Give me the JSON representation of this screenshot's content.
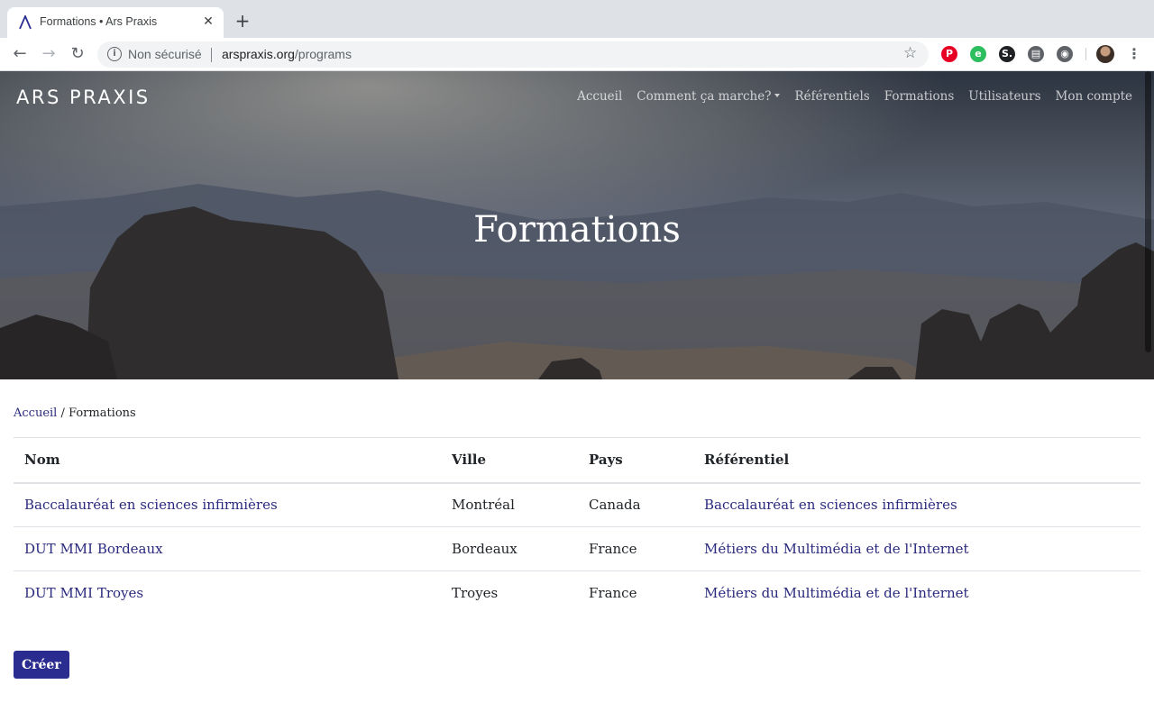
{
  "browser": {
    "tab_title": "Formations • Ars Praxis",
    "new_tab_symbol": "+",
    "close_symbol": "✕",
    "security_label": "Non sécurisé",
    "url_host": "arspraxis.org",
    "url_path": "/programs",
    "extensions": [
      {
        "name": "pinterest-icon",
        "glyph": "P",
        "color": "#e60023"
      },
      {
        "name": "evernote-icon",
        "glyph": "e",
        "color": "#2dbe60"
      },
      {
        "name": "dollar-extension-icon",
        "glyph": "S.",
        "color": "#202124"
      },
      {
        "name": "document-icon",
        "glyph": "▤",
        "color": "#5f6368"
      },
      {
        "name": "camera-icon",
        "glyph": "◉",
        "color": "#5f6368"
      }
    ]
  },
  "site": {
    "logo": "ARS PRAXIS",
    "nav": [
      {
        "label": "Accueil",
        "dropdown": false
      },
      {
        "label": "Comment ça marche?",
        "dropdown": true
      },
      {
        "label": "Référentiels",
        "dropdown": false
      },
      {
        "label": "Formations",
        "dropdown": false
      },
      {
        "label": "Utilisateurs",
        "dropdown": false
      },
      {
        "label": "Mon compte",
        "dropdown": false
      }
    ],
    "hero_title": "Formations"
  },
  "breadcrumb": {
    "home": "Accueil",
    "separator": "/",
    "current": "Formations"
  },
  "table": {
    "headers": [
      "Nom",
      "Ville",
      "Pays",
      "Référentiel"
    ],
    "rows": [
      [
        "Baccalauréat en sciences infirmières",
        "Montréal",
        "Canada",
        "Baccalauréat en sciences infirmières"
      ],
      [
        "DUT MMI Bordeaux",
        "Bordeaux",
        "France",
        "Métiers du Multimédia et de l'Internet"
      ],
      [
        "DUT MMI Troyes",
        "Troyes",
        "France",
        "Métiers du Multimédia et de l'Internet"
      ]
    ]
  },
  "actions": {
    "create_label": "Créer"
  },
  "colors": {
    "link": "#2a2a7e",
    "button": "#2b2c8f"
  }
}
